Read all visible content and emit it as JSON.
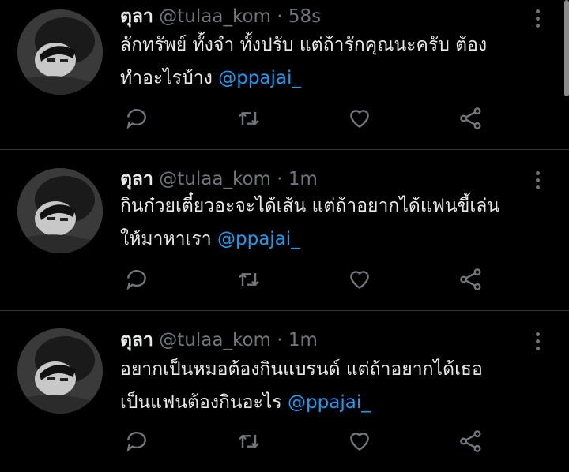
{
  "tweets": [
    {
      "name": "ตุลา",
      "handle": "@tulaa_kom",
      "separator": "·",
      "time": "58s",
      "line1": "ลักทรัพย์ ทั้งจำ ทั้งปรับ แต่ถ้ารักคุณนะครับ ต้อง",
      "line2": "ทำอะไรบ้าง",
      "mention": "@ppajai_"
    },
    {
      "name": "ตุลา",
      "handle": "@tulaa_kom",
      "separator": "·",
      "time": "1m",
      "line1": "กินก๋วยเตี๋ยวอะจะได้เส้น แต่ถ้าอยากได้แฟนขี้เล่น",
      "line2": "ให้มาหาเรา",
      "mention": "@ppajai_"
    },
    {
      "name": "ตุลา",
      "handle": "@tulaa_kom",
      "separator": "·",
      "time": "1m",
      "line1": "อยากเป็นหมอต้องกินแบรนด์ แต่ถ้าอยากได้เธอ",
      "line2": "เป็นแฟนต้องกินอะไร",
      "mention": "@ppajai_"
    }
  ],
  "icons": {
    "reply": "reply-icon",
    "retweet": "retweet-icon",
    "like": "like-icon",
    "share": "share-icon",
    "more": "more-icon"
  },
  "colors": {
    "background": "#000000",
    "text": "#e7e9ea",
    "muted": "#71767b",
    "mention": "#1d9bf0",
    "divider": "#2f3336"
  }
}
